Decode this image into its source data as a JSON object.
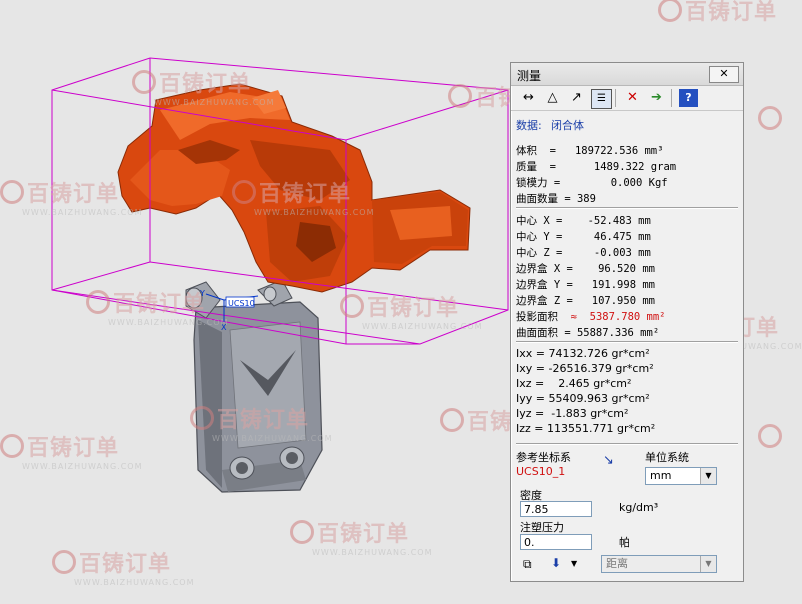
{
  "colors": {
    "part_orange": "#d9480f",
    "bbox_magenta": "#cc00cc",
    "panel_bg": "#f0f0f0",
    "highlight_red": "#d01010",
    "label_blue": "#1a3ea8"
  },
  "watermarks": [
    {
      "brand": "百铸订单",
      "url": "WWW.BAIZHUWANG.COM"
    }
  ],
  "scene": {
    "ucs_label": "UCS10",
    "axis_y": "Y",
    "axis_x": "X"
  },
  "panel": {
    "title": "测量",
    "close_label": "✕",
    "toolbar_icons": [
      "distance-icon",
      "triangle-icon",
      "angle-icon",
      "properties-icon",
      "delete-icon",
      "export-icon",
      "help-icon"
    ],
    "data_label": "数据:",
    "data_value": "闭合体",
    "summary": [
      {
        "label": "体积  =   ",
        "value": "189722.536 mm³"
      },
      {
        "label": "质量  =      ",
        "value": "1489.322 gram"
      },
      {
        "label": "锁模力 =        ",
        "value": "0.000 Kgf"
      },
      {
        "label": "曲面数量 = ",
        "value": "389"
      }
    ],
    "geometry": [
      {
        "label": "中心 X =    ",
        "value": "-52.483 mm"
      },
      {
        "label": "中心 Y =     ",
        "value": "46.475 mm"
      },
      {
        "label": "中心 Z =     ",
        "value": "-0.003 mm"
      },
      {
        "label": "边界盒 X =    ",
        "value": "96.520 mm"
      },
      {
        "label": "边界盒 Y =   ",
        "value": "191.998 mm"
      },
      {
        "label": "边界盒 Z =   ",
        "value": "107.950 mm"
      }
    ],
    "projected_label": "投影面积",
    "projected_symbol": "≈",
    "projected_value": "5387.780 mm²",
    "surface_area": {
      "label": "曲面面积 = ",
      "value": "55887.336 mm²"
    },
    "inertia": [
      "Ixx = 74132.726 gr*cm²",
      "Ixy = -26516.379 gr*cm²",
      "Ixz =    2.465 gr*cm²",
      "Iyy = 55409.963 gr*cm²",
      "Iyz =  -1.883 gr*cm²",
      "Izz = 113551.771 gr*cm²"
    ],
    "ref_coord_label": "参考坐标系",
    "ref_coord_value": "UCS10_1",
    "unit_system_label": "单位系统",
    "unit_value": "mm",
    "density_label": "密度",
    "density_value": "7.85",
    "density_unit": "kg/dm³",
    "pressure_label": "注塑压力",
    "pressure_value": "0.",
    "pressure_unit": "帕",
    "distance_select": "距离"
  }
}
